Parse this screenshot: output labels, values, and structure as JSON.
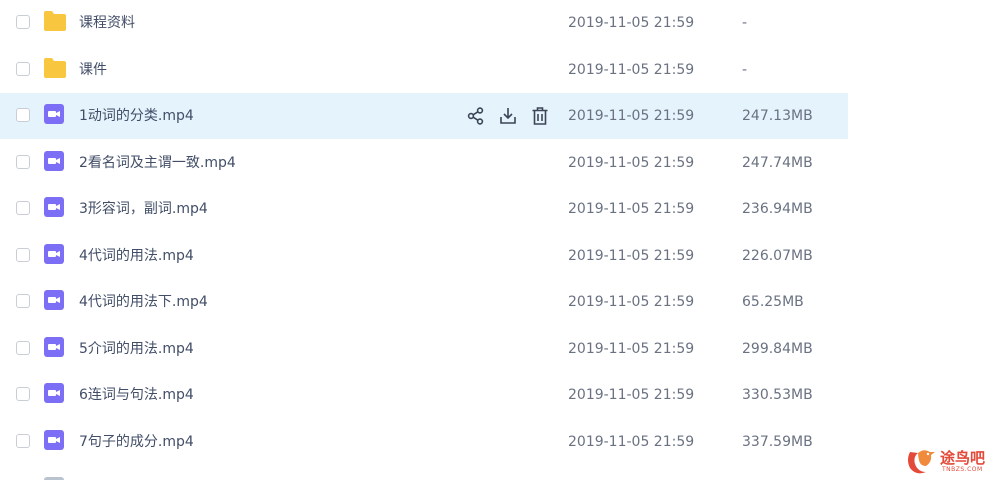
{
  "files": [
    {
      "type": "folder",
      "name": "课程资料",
      "date": "2019-11-05 21:59",
      "size": "-"
    },
    {
      "type": "folder",
      "name": "课件",
      "date": "2019-11-05 21:59",
      "size": "-"
    },
    {
      "type": "video",
      "name": "1动词的分类.mp4",
      "date": "2019-11-05 21:59",
      "size": "247.13MB"
    },
    {
      "type": "video",
      "name": "2看名词及主谓一致.mp4",
      "date": "2019-11-05 21:59",
      "size": "247.74MB"
    },
    {
      "type": "video",
      "name": "3形容词，副词.mp4",
      "date": "2019-11-05 21:59",
      "size": "236.94MB"
    },
    {
      "type": "video",
      "name": "4代词的用法.mp4",
      "date": "2019-11-05 21:59",
      "size": "226.07MB"
    },
    {
      "type": "video",
      "name": "4代词的用法下.mp4",
      "date": "2019-11-05 21:59",
      "size": "65.25MB"
    },
    {
      "type": "video",
      "name": "5介词的用法.mp4",
      "date": "2019-11-05 21:59",
      "size": "299.84MB"
    },
    {
      "type": "video",
      "name": "6连词与句法.mp4",
      "date": "2019-11-05 21:59",
      "size": "330.53MB"
    },
    {
      "type": "video",
      "name": "7句子的成分.mp4",
      "date": "2019-11-05 21:59",
      "size": "337.59MB"
    }
  ],
  "row_actions": {
    "icons": [
      "share-icon",
      "download-icon",
      "delete-icon"
    ]
  },
  "watermark": {
    "text": "途鸟吧",
    "subtext": "TNBZS.COM"
  },
  "colors": {
    "highlight_row": "#e5f3fc",
    "folder": "#f9c73f",
    "video": "#7d6ff5",
    "text": "#424e67",
    "muted": "#6a7282"
  }
}
